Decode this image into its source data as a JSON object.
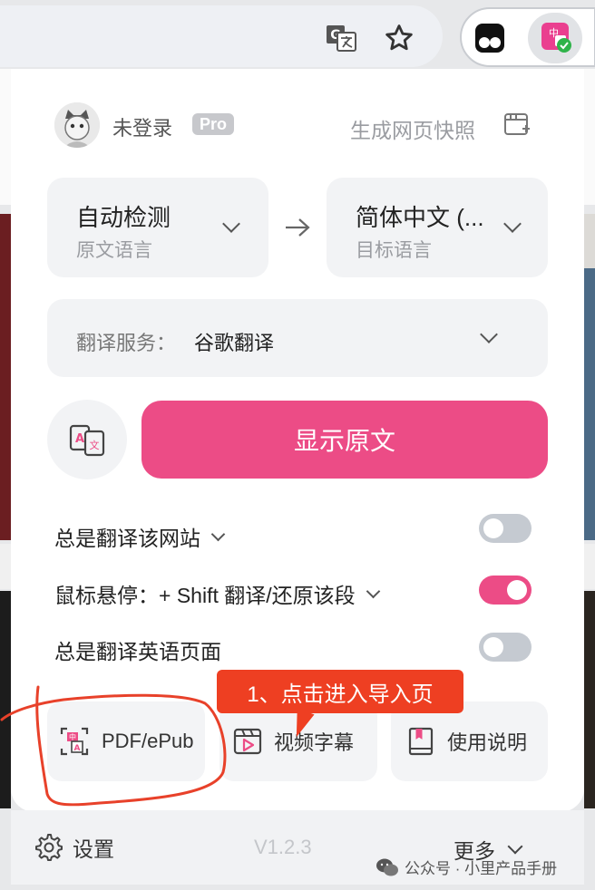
{
  "header": {
    "login_text": "未登录",
    "pro_badge": "Pro",
    "snapshot_label": "生成网页快照"
  },
  "source_lang": {
    "value": "自动检测",
    "caption": "原文语言"
  },
  "target_lang": {
    "value": "简体中文 (...",
    "caption": "目标语言"
  },
  "service": {
    "label": "翻译服务：",
    "value": "谷歌翻译"
  },
  "show_original_button": "显示原文",
  "options": [
    {
      "label": "总是翻译该网站",
      "has_dropdown": true,
      "enabled": false
    },
    {
      "label": "鼠标悬停：+ Shift 翻译/还原该段",
      "has_dropdown": true,
      "enabled": true
    },
    {
      "label": "总是翻译英语页面",
      "has_dropdown": false,
      "enabled": false
    }
  ],
  "tools": {
    "pdf": "PDF/ePub",
    "video": "视频字幕",
    "manual": "使用说明"
  },
  "annotation": {
    "callout_text": "1、点击进入导入页"
  },
  "footer": {
    "settings": "设置",
    "version": "V1.2.3",
    "more": "更多"
  },
  "watermark": "公众号 · 小里产品手册",
  "colors": {
    "accent": "#ec4c86",
    "callout": "#ee3f22",
    "toggle_off": "#c5cad1",
    "panel_bg": "#f2f3f5"
  }
}
